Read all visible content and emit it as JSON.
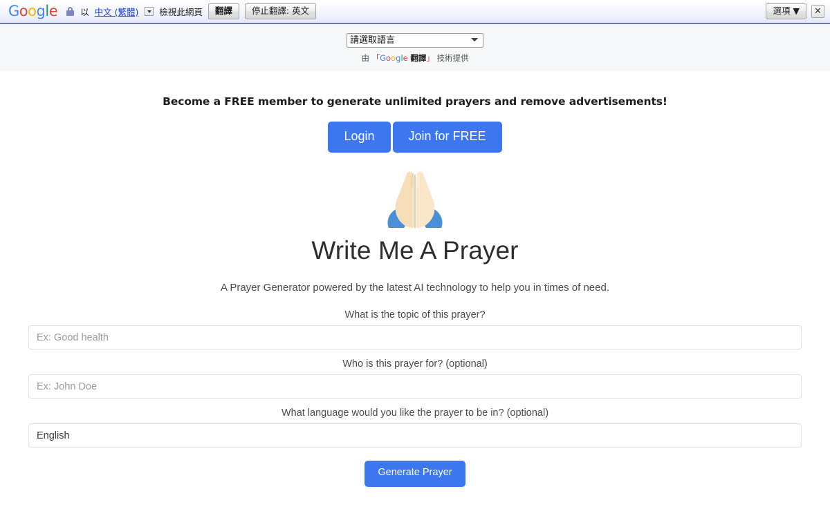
{
  "google_bar": {
    "logo": "Google",
    "secure_icon": "lock-icon",
    "by_label": "以",
    "language_link": "中文 (繁體)",
    "language_dropdown_icon": "chevron-down-icon",
    "view_original_label": "檢視此網頁",
    "translate_button": "翻譯",
    "stop_translate_button": "停止翻譯: 英文",
    "options_button": "選項 ▼",
    "close_button": "✕"
  },
  "translate_strip": {
    "select_value": "請選取語言",
    "select_options": [
      "請選取語言"
    ],
    "attribution_prefix": "由",
    "attribution_open_quote": "「",
    "attribution_google": "Google",
    "attribution_translate": "翻譯",
    "attribution_close_quote": "」",
    "attribution_suffix": "技術提供"
  },
  "promo": {
    "text": "Become a FREE member to generate unlimited prayers and remove advertisements!",
    "login_label": "Login",
    "join_label": "Join for FREE",
    "button_color": "#3c77f0"
  },
  "hero": {
    "emoji_name": "folded-hands-emoji",
    "title": "Write Me A Prayer",
    "subtitle": "A Prayer Generator powered by the latest AI technology to help you in times of need."
  },
  "form": {
    "topic": {
      "label": "What is the topic of this prayer?",
      "placeholder": "Ex: Good health",
      "value": ""
    },
    "recipient": {
      "label": "Who is this prayer for? (optional)",
      "placeholder": "Ex: John Doe",
      "value": ""
    },
    "language": {
      "label": "What language would you like the prayer to be in? (optional)",
      "placeholder": "",
      "value": "English"
    },
    "submit_label": "Generate Prayer"
  }
}
